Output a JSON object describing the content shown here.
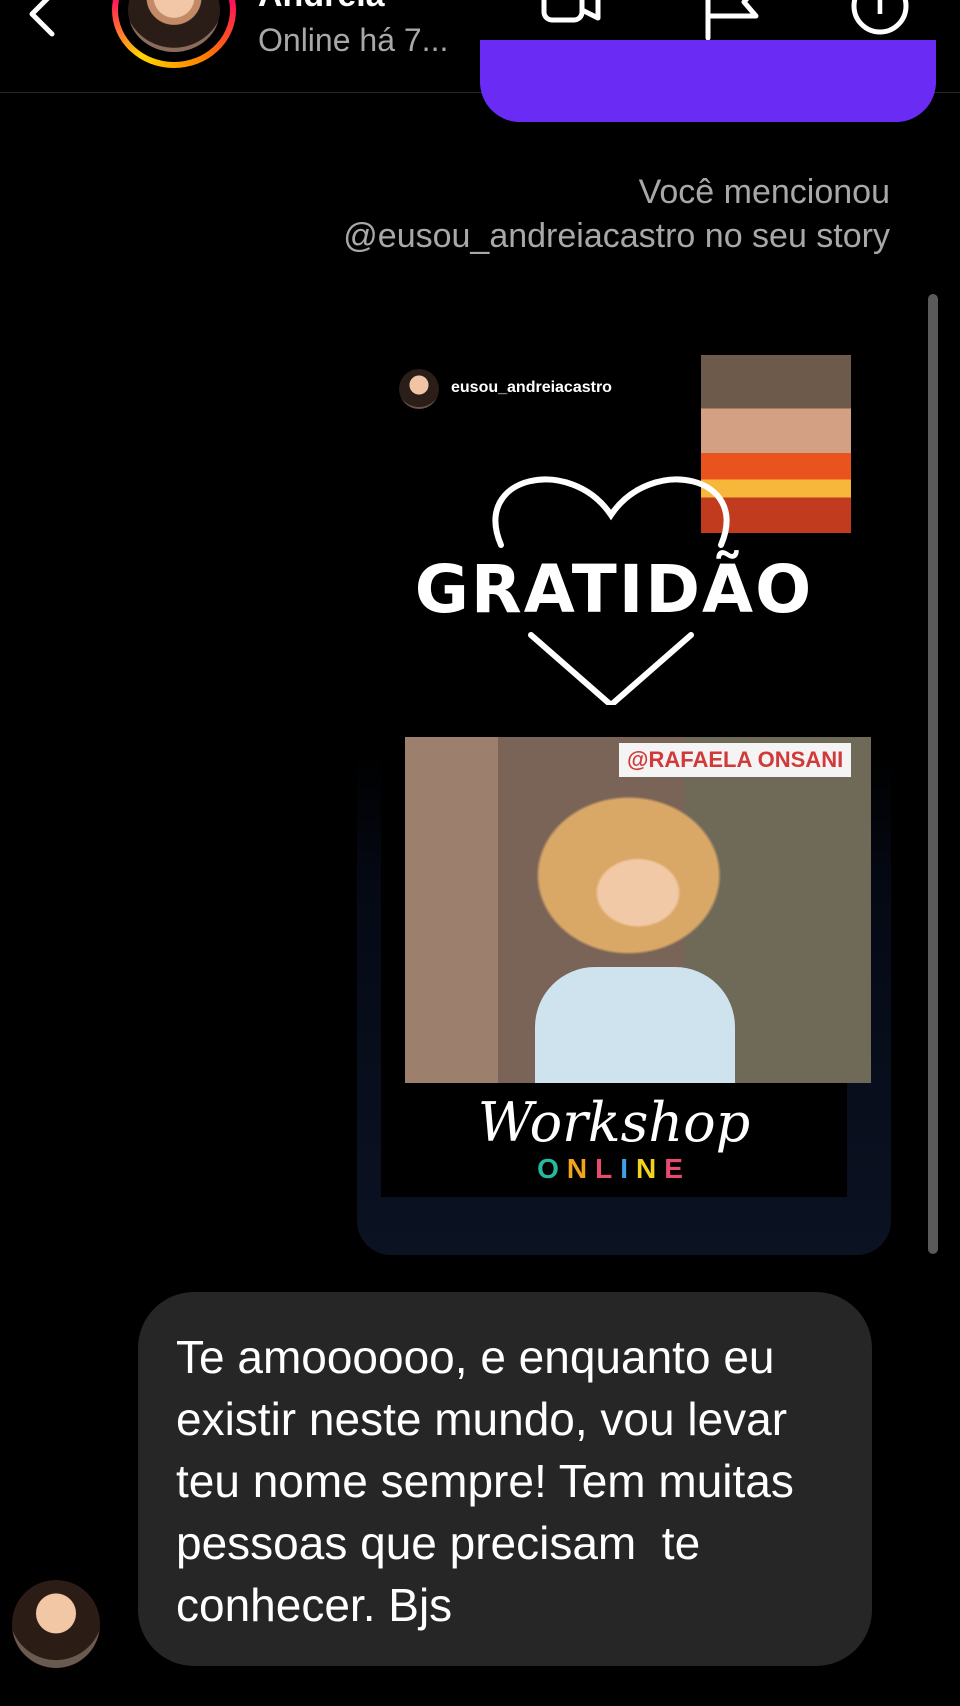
{
  "header": {
    "contact_name": "Andreia",
    "status": "Online há 7...",
    "icons": [
      "back-arrow-icon",
      "video-call-icon",
      "flag-icon",
      "info-icon"
    ]
  },
  "conversation": {
    "mention_note_line1": "Você mencionou",
    "mention_note_line2": "@eusou_andreiacastro no seu story",
    "story": {
      "username": "eusou_andreiacastro",
      "headline": "GRATIDÃO",
      "video_tag": "@RAFAELA ONSANI",
      "workshop_title": "Workshop",
      "workshop_subtitle_letters": [
        "O",
        "N",
        "L",
        "I",
        "N",
        "E"
      ]
    },
    "received_message": "Te amoooooo, e enquanto eu existir neste mundo, vou levar teu nome sempre! Tem muitas pessoas que precisam  te conhecer. Bjs"
  },
  "colors": {
    "background": "#000000",
    "sent_bubble": "#6a2bf5",
    "received_bubble": "#262626",
    "secondary_text": "#a8a8a8"
  }
}
